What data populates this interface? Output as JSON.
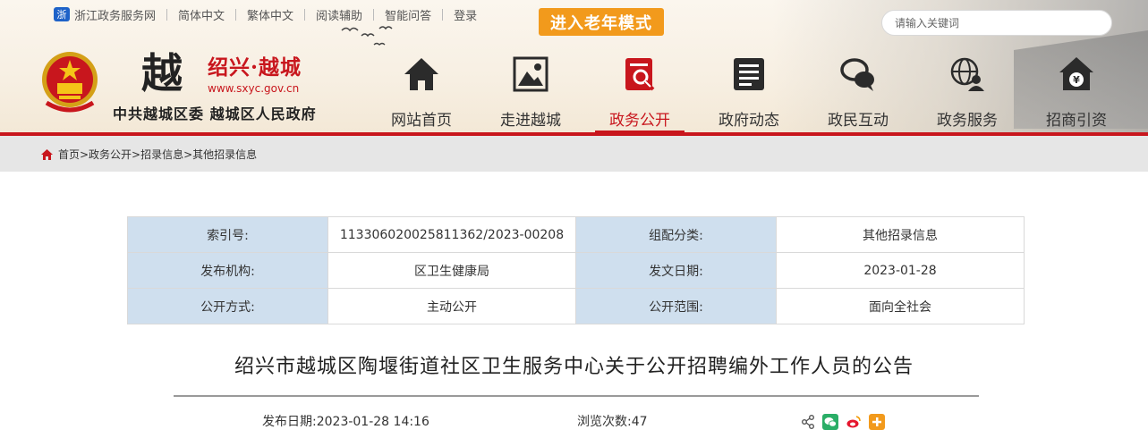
{
  "topbar": {
    "portal": "浙江政务服务网",
    "simplified": "简体中文",
    "traditional": "繁体中文",
    "reading_aid": "阅读辅助",
    "smart_qa": "智能问答",
    "login": "登录",
    "elder_mode": "进入老年模式"
  },
  "search": {
    "placeholder": "请输入关键词"
  },
  "brand": {
    "logo_char": "越",
    "site_name": "绍兴·越城",
    "url": "www.sxyc.gov.cn",
    "org": "中共越城区委 越城区人民政府"
  },
  "nav": [
    {
      "label": "网站首页",
      "icon": "home-icon"
    },
    {
      "label": "走进越城",
      "icon": "picture-icon"
    },
    {
      "label": "政务公开",
      "icon": "search-document-icon"
    },
    {
      "label": "政府动态",
      "icon": "news-list-icon"
    },
    {
      "label": "政民互动",
      "icon": "chat-bubbles-icon"
    },
    {
      "label": "政务服务",
      "icon": "globe-user-icon"
    },
    {
      "label": "招商引资",
      "icon": "yuan-house-icon"
    }
  ],
  "breadcrumb": "首页>政务公开>招录信息>其他招录信息",
  "meta": {
    "index_label": "索引号:",
    "index_value": "113306020025811362/2023-00208",
    "category_label": "组配分类:",
    "category_value": "其他招录信息",
    "publisher_label": "发布机构:",
    "publisher_value": "区卫生健康局",
    "issue_date_label": "发文日期:",
    "issue_date_value": "2023-01-28",
    "method_label": "公开方式:",
    "method_value": "主动公开",
    "scope_label": "公开范围:",
    "scope_value": "面向全社会"
  },
  "article": {
    "title": "绍兴市越城区陶堰街道社区卫生服务中心关于公开招聘编外工作人员的公告",
    "publish_label": "发布日期:",
    "publish_value": "2023-01-28 14:16",
    "views_label": "浏览次数:",
    "views_value": "47"
  },
  "colors": {
    "accent": "#c8161d",
    "elder": "#f29a1c",
    "meta_key_bg": "#cfdfee"
  }
}
